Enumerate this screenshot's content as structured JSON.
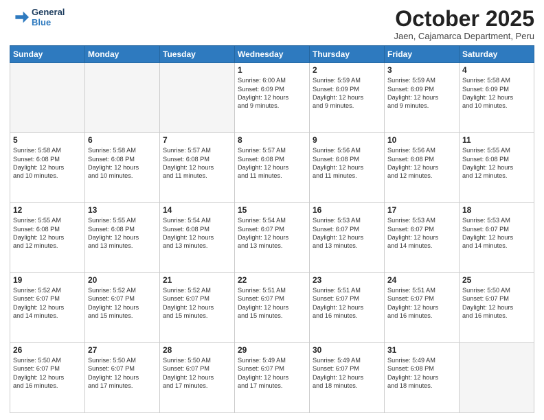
{
  "header": {
    "logo_line1": "General",
    "logo_line2": "Blue",
    "month": "October 2025",
    "location": "Jaen, Cajamarca Department, Peru"
  },
  "weekdays": [
    "Sunday",
    "Monday",
    "Tuesday",
    "Wednesday",
    "Thursday",
    "Friday",
    "Saturday"
  ],
  "rows": [
    [
      {
        "day": "",
        "lines": [],
        "empty": true
      },
      {
        "day": "",
        "lines": [],
        "empty": true
      },
      {
        "day": "",
        "lines": [],
        "empty": true
      },
      {
        "day": "1",
        "lines": [
          "Sunrise: 6:00 AM",
          "Sunset: 6:09 PM",
          "Daylight: 12 hours",
          "and 9 minutes."
        ]
      },
      {
        "day": "2",
        "lines": [
          "Sunrise: 5:59 AM",
          "Sunset: 6:09 PM",
          "Daylight: 12 hours",
          "and 9 minutes."
        ]
      },
      {
        "day": "3",
        "lines": [
          "Sunrise: 5:59 AM",
          "Sunset: 6:09 PM",
          "Daylight: 12 hours",
          "and 9 minutes."
        ]
      },
      {
        "day": "4",
        "lines": [
          "Sunrise: 5:58 AM",
          "Sunset: 6:09 PM",
          "Daylight: 12 hours",
          "and 10 minutes."
        ]
      }
    ],
    [
      {
        "day": "5",
        "lines": [
          "Sunrise: 5:58 AM",
          "Sunset: 6:08 PM",
          "Daylight: 12 hours",
          "and 10 minutes."
        ]
      },
      {
        "day": "6",
        "lines": [
          "Sunrise: 5:58 AM",
          "Sunset: 6:08 PM",
          "Daylight: 12 hours",
          "and 10 minutes."
        ]
      },
      {
        "day": "7",
        "lines": [
          "Sunrise: 5:57 AM",
          "Sunset: 6:08 PM",
          "Daylight: 12 hours",
          "and 11 minutes."
        ]
      },
      {
        "day": "8",
        "lines": [
          "Sunrise: 5:57 AM",
          "Sunset: 6:08 PM",
          "Daylight: 12 hours",
          "and 11 minutes."
        ]
      },
      {
        "day": "9",
        "lines": [
          "Sunrise: 5:56 AM",
          "Sunset: 6:08 PM",
          "Daylight: 12 hours",
          "and 11 minutes."
        ]
      },
      {
        "day": "10",
        "lines": [
          "Sunrise: 5:56 AM",
          "Sunset: 6:08 PM",
          "Daylight: 12 hours",
          "and 12 minutes."
        ]
      },
      {
        "day": "11",
        "lines": [
          "Sunrise: 5:55 AM",
          "Sunset: 6:08 PM",
          "Daylight: 12 hours",
          "and 12 minutes."
        ]
      }
    ],
    [
      {
        "day": "12",
        "lines": [
          "Sunrise: 5:55 AM",
          "Sunset: 6:08 PM",
          "Daylight: 12 hours",
          "and 12 minutes."
        ]
      },
      {
        "day": "13",
        "lines": [
          "Sunrise: 5:55 AM",
          "Sunset: 6:08 PM",
          "Daylight: 12 hours",
          "and 13 minutes."
        ]
      },
      {
        "day": "14",
        "lines": [
          "Sunrise: 5:54 AM",
          "Sunset: 6:08 PM",
          "Daylight: 12 hours",
          "and 13 minutes."
        ]
      },
      {
        "day": "15",
        "lines": [
          "Sunrise: 5:54 AM",
          "Sunset: 6:07 PM",
          "Daylight: 12 hours",
          "and 13 minutes."
        ]
      },
      {
        "day": "16",
        "lines": [
          "Sunrise: 5:53 AM",
          "Sunset: 6:07 PM",
          "Daylight: 12 hours",
          "and 13 minutes."
        ]
      },
      {
        "day": "17",
        "lines": [
          "Sunrise: 5:53 AM",
          "Sunset: 6:07 PM",
          "Daylight: 12 hours",
          "and 14 minutes."
        ]
      },
      {
        "day": "18",
        "lines": [
          "Sunrise: 5:53 AM",
          "Sunset: 6:07 PM",
          "Daylight: 12 hours",
          "and 14 minutes."
        ]
      }
    ],
    [
      {
        "day": "19",
        "lines": [
          "Sunrise: 5:52 AM",
          "Sunset: 6:07 PM",
          "Daylight: 12 hours",
          "and 14 minutes."
        ]
      },
      {
        "day": "20",
        "lines": [
          "Sunrise: 5:52 AM",
          "Sunset: 6:07 PM",
          "Daylight: 12 hours",
          "and 15 minutes."
        ]
      },
      {
        "day": "21",
        "lines": [
          "Sunrise: 5:52 AM",
          "Sunset: 6:07 PM",
          "Daylight: 12 hours",
          "and 15 minutes."
        ]
      },
      {
        "day": "22",
        "lines": [
          "Sunrise: 5:51 AM",
          "Sunset: 6:07 PM",
          "Daylight: 12 hours",
          "and 15 minutes."
        ]
      },
      {
        "day": "23",
        "lines": [
          "Sunrise: 5:51 AM",
          "Sunset: 6:07 PM",
          "Daylight: 12 hours",
          "and 16 minutes."
        ]
      },
      {
        "day": "24",
        "lines": [
          "Sunrise: 5:51 AM",
          "Sunset: 6:07 PM",
          "Daylight: 12 hours",
          "and 16 minutes."
        ]
      },
      {
        "day": "25",
        "lines": [
          "Sunrise: 5:50 AM",
          "Sunset: 6:07 PM",
          "Daylight: 12 hours",
          "and 16 minutes."
        ]
      }
    ],
    [
      {
        "day": "26",
        "lines": [
          "Sunrise: 5:50 AM",
          "Sunset: 6:07 PM",
          "Daylight: 12 hours",
          "and 16 minutes."
        ]
      },
      {
        "day": "27",
        "lines": [
          "Sunrise: 5:50 AM",
          "Sunset: 6:07 PM",
          "Daylight: 12 hours",
          "and 17 minutes."
        ]
      },
      {
        "day": "28",
        "lines": [
          "Sunrise: 5:50 AM",
          "Sunset: 6:07 PM",
          "Daylight: 12 hours",
          "and 17 minutes."
        ]
      },
      {
        "day": "29",
        "lines": [
          "Sunrise: 5:49 AM",
          "Sunset: 6:07 PM",
          "Daylight: 12 hours",
          "and 17 minutes."
        ]
      },
      {
        "day": "30",
        "lines": [
          "Sunrise: 5:49 AM",
          "Sunset: 6:07 PM",
          "Daylight: 12 hours",
          "and 18 minutes."
        ]
      },
      {
        "day": "31",
        "lines": [
          "Sunrise: 5:49 AM",
          "Sunset: 6:08 PM",
          "Daylight: 12 hours",
          "and 18 minutes."
        ]
      },
      {
        "day": "",
        "lines": [],
        "empty": true
      }
    ]
  ]
}
